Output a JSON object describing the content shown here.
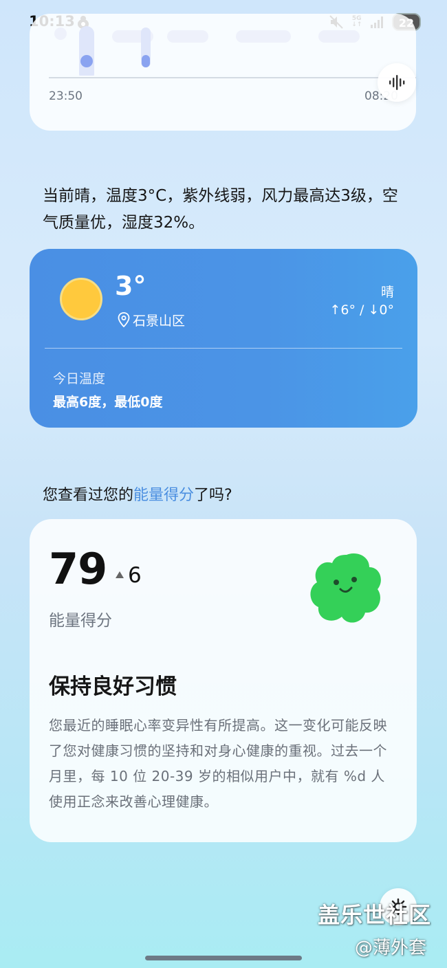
{
  "status_bar": {
    "time": "10:13",
    "network": "5G",
    "battery": "22",
    "icons": [
      "app-notification-icon",
      "mute-icon",
      "signal-icon"
    ]
  },
  "sleep_chart": {
    "start_time": "23:50",
    "end_time": "08:20",
    "accent": "#8aa3f0"
  },
  "weather_summary": "当前晴，温度3°C，紫外线弱，风力最高达3级，空气质量优，湿度32%。",
  "weather_card": {
    "temperature": "3°",
    "location": "石景山区",
    "condition": "晴",
    "range": "↑6° / ↓0°",
    "today_label": "今日温度",
    "today_value": "最高6度，最低0度",
    "background": "#4a8fe4",
    "sun_color": "#ffc93d"
  },
  "energy_prompt": {
    "prefix": "您查看过您的",
    "link": "能量得分",
    "suffix": "了吗?",
    "link_color": "#4a8ee0"
  },
  "energy_card": {
    "score": "79",
    "change": "6",
    "score_label": "能量得分",
    "habit_title": "保持良好习惯",
    "habit_body": "您最近的睡眠心率变异性有所提高。这一变化可能反映了您对健康习惯的坚持和对身心健康的重视。过去一个月里，每 10 位 20-39 岁的相似用户中，就有 %d 人使用正念来改善心理健康。",
    "mascot_color": "#34d058"
  },
  "watermark": {
    "main": "盖乐世社区",
    "sub": "@薄外套"
  }
}
